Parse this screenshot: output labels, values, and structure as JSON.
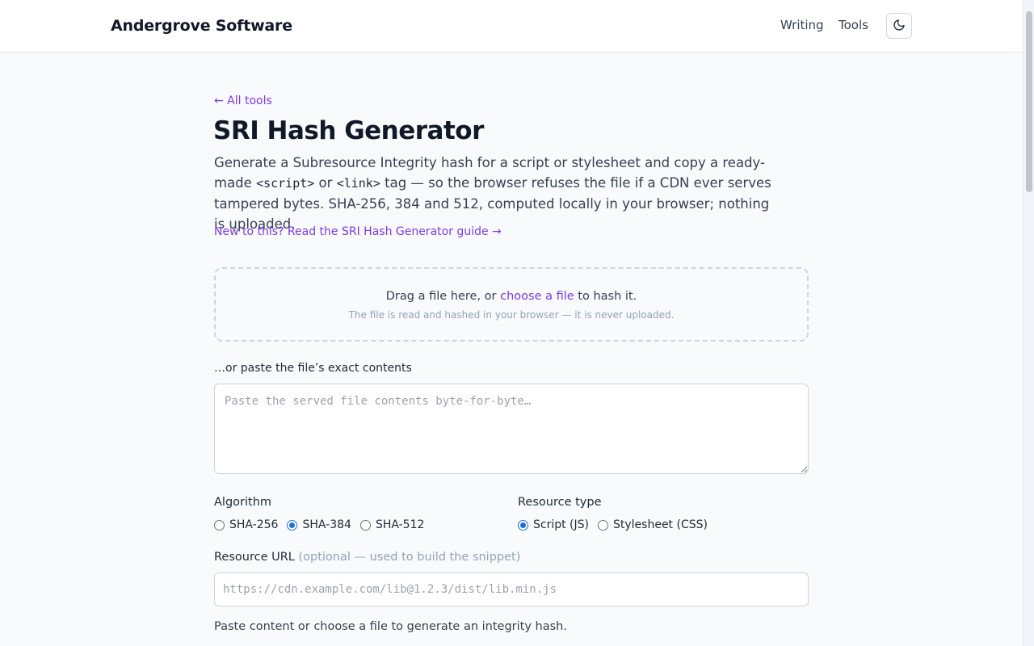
{
  "header": {
    "brand": "Andergrove Software",
    "nav": {
      "writing": "Writing",
      "tools": "Tools"
    },
    "theme_toggle_icon": "moon-icon"
  },
  "page": {
    "back_link": "← All tools",
    "title": "SRI Hash Generator",
    "intro": {
      "part1": "Generate a Subresource Integrity hash for a script or stylesheet and copy a ready-made ",
      "code1": "<script>",
      "part2": " or ",
      "code2": "<link>",
      "part3": " tag — so the browser refuses the file if a CDN ever serves tampered bytes. SHA-256, 384 and 512, computed locally in your browser; nothing is uploaded."
    },
    "guide_link": "New to this? Read the SRI Hash Generator guide →"
  },
  "dropzone": {
    "before": "Drag a file here, or ",
    "link": "choose a file",
    "after": " to hash it.",
    "note": "The file is read and hashed in your browser — it is never uploaded."
  },
  "paste": {
    "label": "…or paste the file’s exact contents",
    "placeholder": "Paste the served file contents byte-for-byte…",
    "value": ""
  },
  "algorithm": {
    "label": "Algorithm",
    "options": [
      "SHA-256",
      "SHA-384",
      "SHA-512"
    ],
    "selected": "SHA-384"
  },
  "resource_type": {
    "label": "Resource type",
    "options": [
      "Script (JS)",
      "Stylesheet (CSS)"
    ],
    "selected": "Script (JS)"
  },
  "url": {
    "label": "Resource URL",
    "hint": "(optional — used to build the snippet)",
    "placeholder": "https://cdn.example.com/lib@1.2.3/dist/lib.min.js",
    "value": ""
  },
  "status": "Paste content or choose a file to generate an integrity hash.",
  "colors": {
    "accent": "#7c3aed",
    "radio_checked": "#1d6fe0",
    "page_bg": "#f8fafc"
  }
}
